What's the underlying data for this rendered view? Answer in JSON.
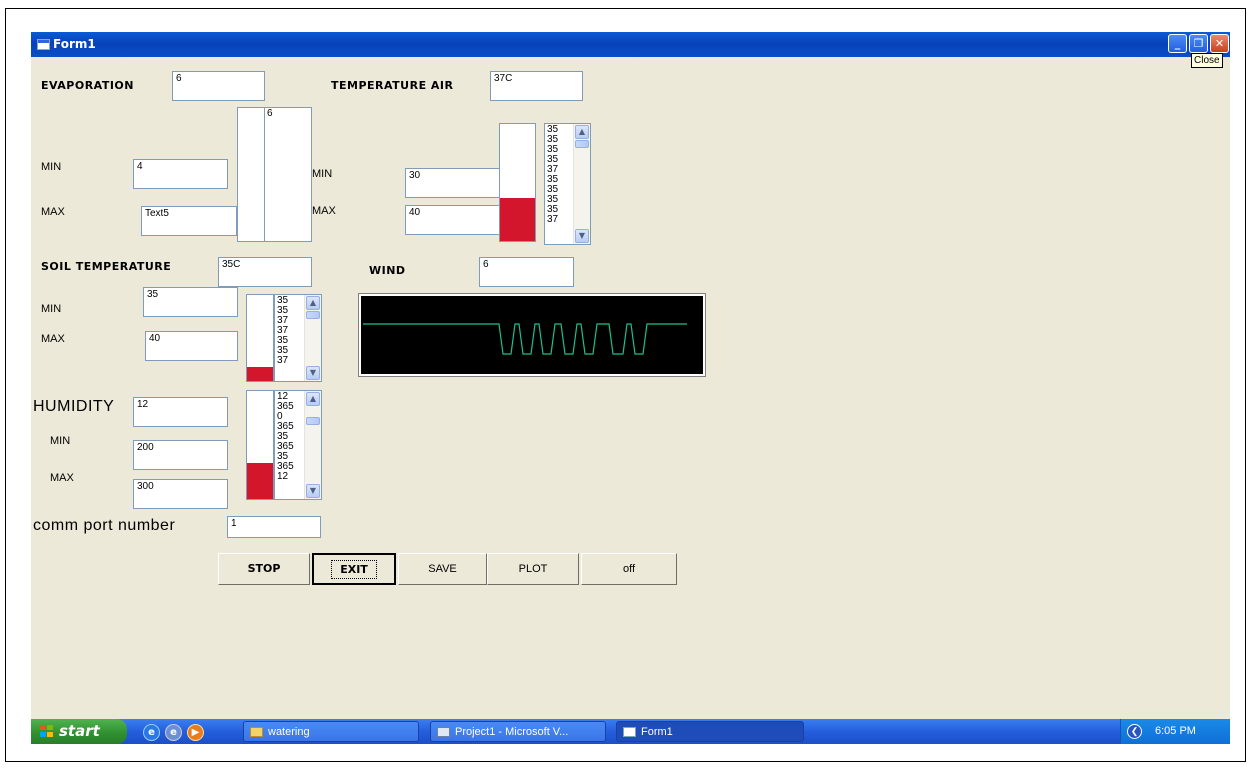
{
  "window": {
    "title": "Form1",
    "close_tooltip": "Close",
    "minimize_glyph": "_",
    "restore_glyph": "❐",
    "close_glyph": "✕"
  },
  "evaporation": {
    "label": "EVAPORATION",
    "value": "6",
    "min_label": "MIN",
    "min_value": "4",
    "max_label": "MAX",
    "max_value": "Text5",
    "list_items": [
      "6"
    ]
  },
  "temperature_air": {
    "label": "TEMPERATURE AIR",
    "value": "37C",
    "min_label": "MIN",
    "min_value": "30",
    "max_label": "MAX",
    "max_value": "40",
    "gauge_level_fraction": 0.37,
    "list_items": [
      "35",
      "35",
      "35",
      "35",
      "37",
      "35",
      "35",
      "35",
      "35",
      "37"
    ]
  },
  "soil_temperature": {
    "label": "SOIL TEMPERATURE",
    "value": "35C",
    "min_label": "MIN",
    "min_value": "35",
    "max_label": "MAX",
    "max_value": "40",
    "gauge_level_fraction": 0.16,
    "list_items": [
      "35",
      "35",
      "37",
      "37",
      "35",
      "35",
      "37"
    ]
  },
  "wind": {
    "label": "WIND",
    "value": "6",
    "trace_color": "#1fbf8f"
  },
  "humidity": {
    "label": "HUMIDITY",
    "value": "12",
    "min_label": "MIN",
    "min_value": "200",
    "max_label": "MAX",
    "max_value": "300",
    "gauge_level_fraction": 0.33,
    "list_items": [
      "12",
      "365",
      "0",
      "365",
      "35",
      "365",
      "35",
      "365",
      "12"
    ]
  },
  "comm_port": {
    "label": "comm port number",
    "value": "1"
  },
  "buttons": {
    "stop": "STOP",
    "exit": "EXIT",
    "save": "SAVE",
    "plot": "PLOT",
    "off": "off"
  },
  "taskbar": {
    "start_label": "start",
    "tasks": [
      {
        "label": "watering",
        "icon": "folder-icon"
      },
      {
        "label": "Project1 - Microsoft V...",
        "icon": "vb-icon"
      },
      {
        "label": "Form1",
        "icon": "form-icon"
      }
    ],
    "clock": "6:05 PM",
    "colors": {
      "bar": "#245edc",
      "start": "#2f8f2f",
      "tray": "#0f6fd6"
    }
  },
  "colors": {
    "gauge_fill": "#d3162c",
    "form_background": "#ece9d8",
    "scope_background": "#000000"
  }
}
